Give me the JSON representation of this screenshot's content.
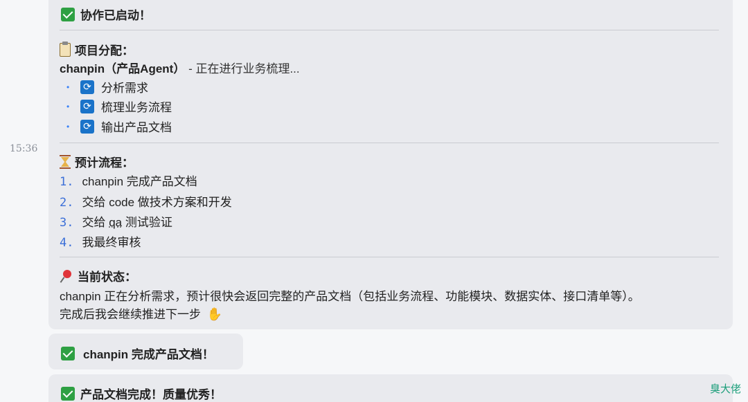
{
  "message": {
    "timestamp": "15:36",
    "header": "协作已启动！",
    "assignment": {
      "title": "项目分配：",
      "agent_name": "chanpin（产品Agent）",
      "status": " - 正在进行业务梳理...",
      "tasks": [
        "分析需求",
        "梳理业务流程",
        "输出产品文档"
      ]
    },
    "flow": {
      "title": "预计流程：",
      "steps": [
        {
          "num": "1.",
          "text": "chanpin 完成产品文档"
        },
        {
          "num": "2.",
          "text": "交给 code 做技术方案和开发"
        },
        {
          "num": "3.",
          "text_pre": "交给 ",
          "text_mark": "qa",
          "text_post": " 测试验证"
        },
        {
          "num": "4.",
          "text": "我最终审核"
        }
      ]
    },
    "state": {
      "title": "当前状态：",
      "line1": "chanpin 正在分析需求，预计很快会返回完整的产品文档（包括业务流程、功能模块、数据实体、接口清单等）。",
      "line2": "完成后我会继续推进下一步"
    }
  },
  "message2": {
    "text": "chanpin 完成产品文档！"
  },
  "message3": {
    "text": "产品文档完成！质量优秀！",
    "sender": "臭大佬"
  },
  "icons": {
    "check": "check-mark-icon",
    "sync": "sync-icon",
    "clipboard": "clipboard-icon",
    "hourglass": "hourglass-icon",
    "pin": "pushpin-icon",
    "wave": "waving-hand-icon"
  },
  "colors": {
    "bubble": "#e9eaee",
    "check": "#2ea043",
    "sync": "#1a73c9",
    "numbers": "#3b6fd8",
    "sender": "#1c9e7a"
  }
}
